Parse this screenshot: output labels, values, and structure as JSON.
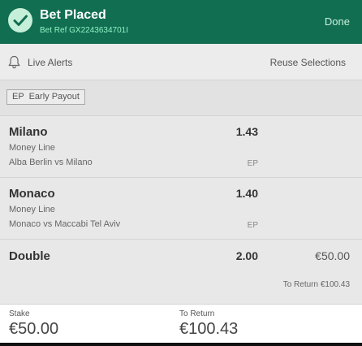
{
  "header": {
    "title": "Bet Placed",
    "bet_ref": "Bet Ref GX2243634701I",
    "done_label": "Done",
    "icon": "check-circle-icon"
  },
  "toolbar": {
    "live_alerts_label": "Live Alerts",
    "live_alerts_icon": "bell-icon",
    "reuse_label": "Reuse Selections"
  },
  "tag": {
    "label": "EP  Early Payout"
  },
  "selections": [
    {
      "name": "Milano",
      "odds": "1.43",
      "market": "Money Line",
      "event": "Alba Berlin vs Milano",
      "badge": "EP"
    },
    {
      "name": "Monaco",
      "odds": "1.40",
      "market": "Money Line",
      "event": "Monaco vs Maccabi Tel Aviv",
      "badge": "EP"
    }
  ],
  "double": {
    "name": "Double",
    "odds": "2.00",
    "stake": "€50.00",
    "to_return": "To Return €100.43"
  },
  "footer": {
    "stake_label": "Stake",
    "stake_value": "€50.00",
    "return_label": "To Return",
    "return_value": "€100.43"
  },
  "colors": {
    "header_bg": "#126e51",
    "ref_text": "#8ff2c4"
  }
}
